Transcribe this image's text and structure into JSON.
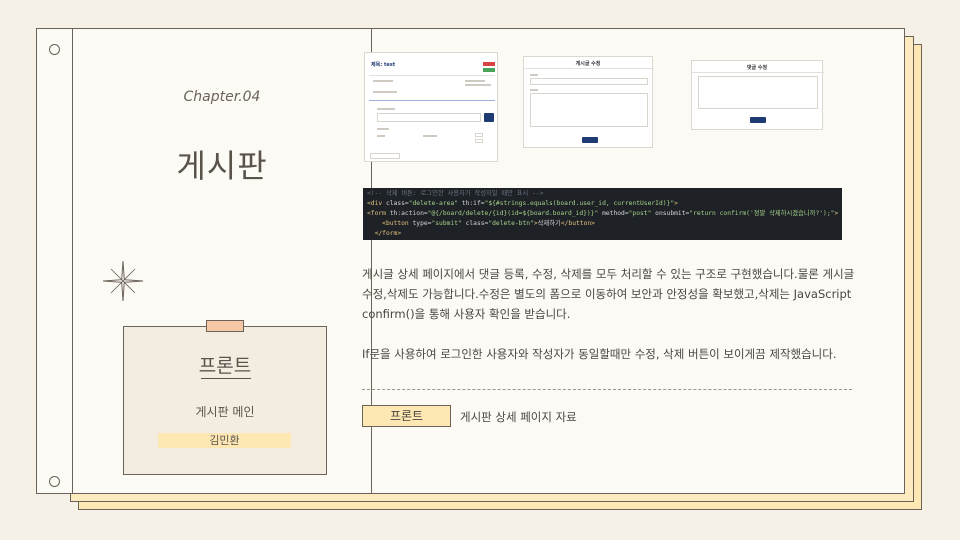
{
  "chapter": "Chapter.04",
  "section_title": "게시판",
  "card": {
    "title": "프론트",
    "subtitle": "게시판 메인",
    "author": "김민환"
  },
  "screenshots": {
    "detail_title": "제목: test",
    "edit_post_title": "게시글 수정",
    "edit_comment_title": "댓글 수정"
  },
  "code_lines": [
    {
      "comment": "<!-- 삭제 버튼: 로그인한 사용자가 작성자일 때만 표시 -->"
    },
    {
      "tag": "<div",
      "plain": " class=",
      "str": "\"delete-area\"",
      "plain2": " th:if=",
      "str2": "\"${#strings.equals(board.user_id, currentUserId)}\"",
      "tag2": ">"
    },
    {
      "tag": "<form",
      "plain": " th:action=",
      "str": "\"@{/board/delete/{id}(id=${board.board_id})}\"",
      "plain2": " method=",
      "str2": "\"post\"",
      "plain3": " onsubmit=",
      "str3": "\"return confirm('정말 삭제하시겠습니까?');\"",
      "tag2": ">"
    },
    {
      "tag": "    <button",
      "plain": " type=",
      "str": "\"submit\"",
      "plain2": " class=",
      "str2": "\"delete-btn\"",
      "tag2": ">",
      "plain3": "삭제하기",
      "tag3": "</button>"
    },
    {
      "tag": "  </form>"
    }
  ],
  "description": {
    "p1": "게시글 상세 페이지에서 댓글 등록, 수정, 삭제를 모두 처리할 수 있는 구조로 구현했습니다.물론 게시글 수정,삭제도 가능합니다.수정은 별도의 폼으로 이동하여 보안과 안정성을 확보했고,삭제는 JavaScript confirm()을 통해 사용자 확인을 받습니다.",
    "p2": "If문을 사용하여 로그인한 사용자와 작성자가 동일할때만 수정, 삭제 버튼이 보이게끔 제작했습니다."
  },
  "footer": {
    "tag": "프론트",
    "label": "게시판 상세 페이지 자료"
  },
  "colors": {
    "background": "#f6f1e6",
    "paper": "#fcfaf4",
    "accent_yellow": "#fde7b3",
    "tape": "#f6c7a4",
    "code_bg": "#1e2227"
  }
}
